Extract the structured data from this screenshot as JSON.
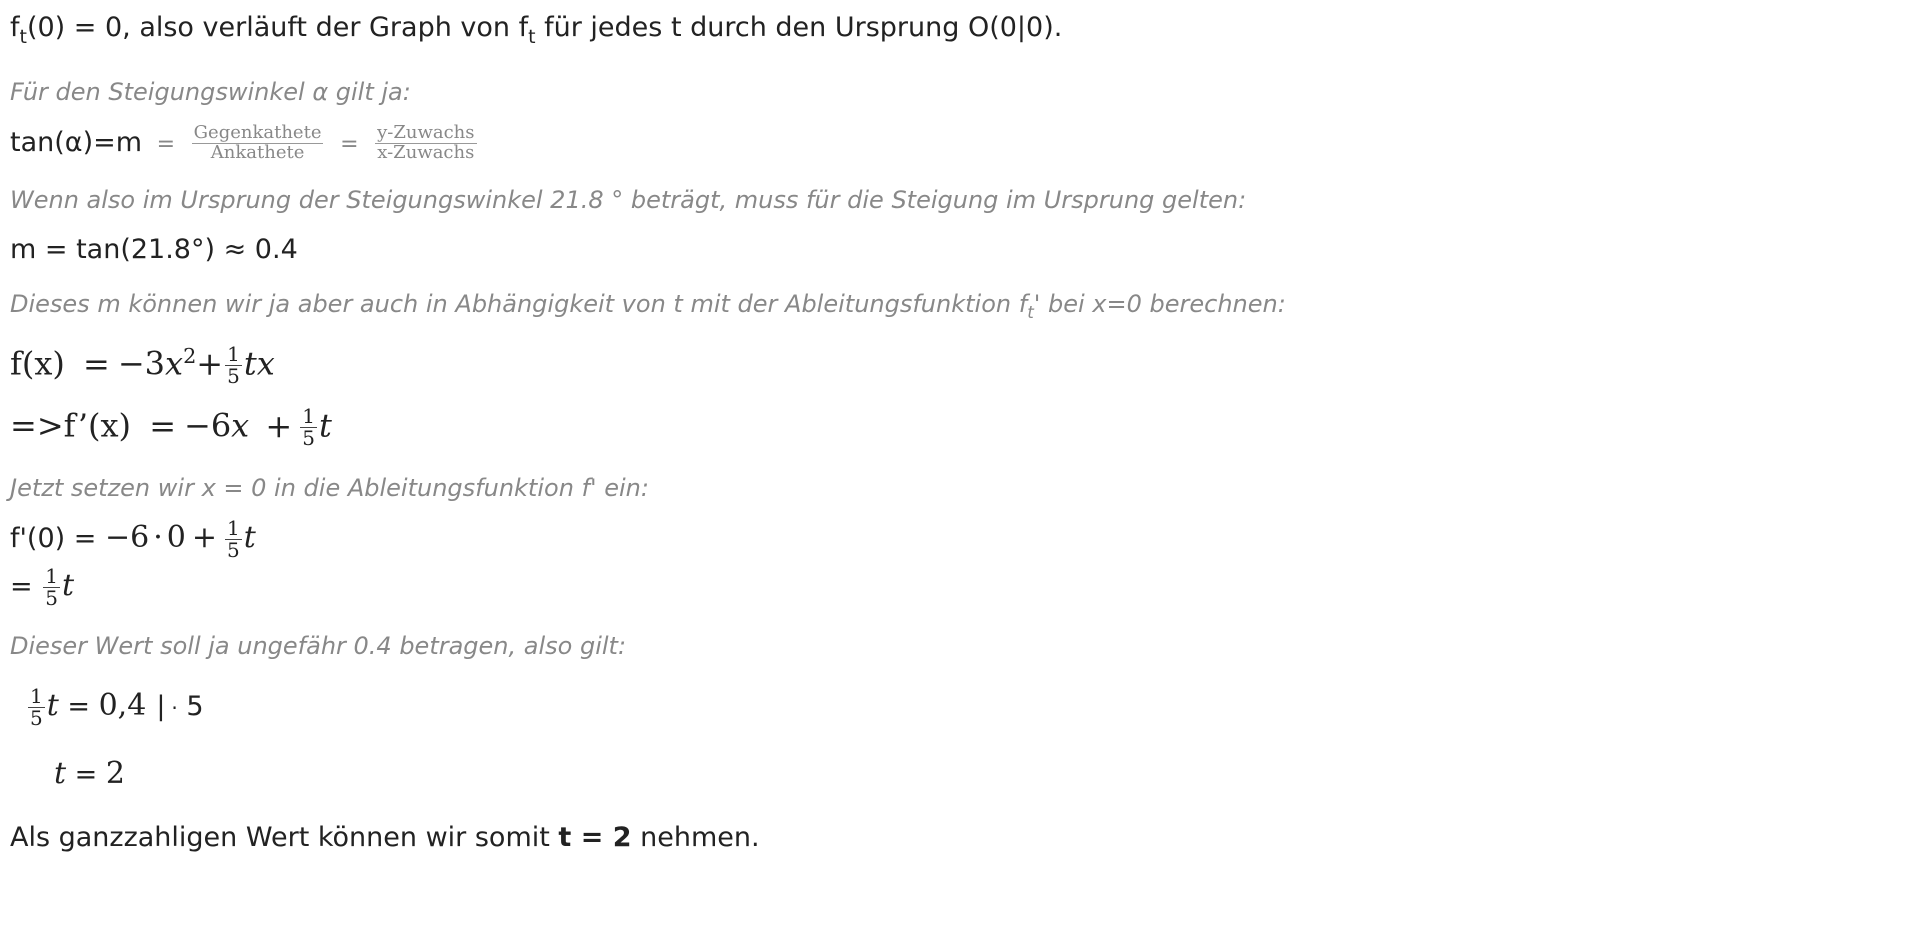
{
  "line1": {
    "f": "f",
    "sub": "t",
    "a": "(0) = 0, also verläuft der Graph von ",
    "f2": "f",
    "sub2": "t",
    "b": " für jedes t durch den Ursprung O(0|0)."
  },
  "hint1": "Für den Steigungswinkel α gilt ja:",
  "tan_line": {
    "lhs": "tan(α)=m",
    "eq1": "=",
    "frac1_num": "Gegenkathete",
    "frac1_den": "Ankathete",
    "eq2": "=",
    "frac2_num": "y-Zuwachs",
    "frac2_den": "x-Zuwachs"
  },
  "hint2": "Wenn also im Ursprung der Steigungswinkel 21.8 ° beträgt, muss für die Steigung im Ursprung gelten:",
  "m_line": "m = tan(21.8°) ≈ 0.4",
  "hint3": {
    "a": "Dieses m können wir ja aber auch in Abhängigkeit von t mit der Ableitungsfunktion f",
    "sub": "t",
    "b": "' bei x=0 berechnen:"
  },
  "fx_line": {
    "lhs": "f(x)",
    "eq": "=",
    "minus": "−",
    "coef": "3",
    "var": "x",
    "exp": "2",
    "plus": "+",
    "num": "1",
    "den": "5",
    "tail": "tx"
  },
  "fprime_line": {
    "lhs": "=>f’(x)",
    "eq": "=",
    "minus": "−",
    "coef": "6",
    "var": "x",
    "plus": "+",
    "num": "1",
    "den": "5",
    "tail": "t"
  },
  "hint4": "Jetzt setzen wir x = 0 in die Ableitungsfunktion f' ein:",
  "f0_line": {
    "lhs": "f'(0) = ",
    "minus": "−",
    "six": "6",
    "dot": "·",
    "zero": "0",
    "plus": "+",
    "num": "1",
    "den": "5",
    "tail": "t"
  },
  "eq_line": {
    "lhs": "= ",
    "num": "1",
    "den": "5",
    "tail": "t"
  },
  "hint5": "Dieser Wert soll ja ungefähr 0.4 betragen, also gilt:",
  "solve1": {
    "num": "1",
    "den": "5",
    "var": "t",
    "eq": " = ",
    "val": "0,4",
    "bar": "|",
    "op": "·",
    "five": " 5"
  },
  "solve2": {
    "var": "t",
    "eq": " = ",
    "val": "2"
  },
  "final": {
    "a": "Als ganzzahligen Wert können wir somit ",
    "bold": "t = 2",
    "b": " nehmen."
  }
}
